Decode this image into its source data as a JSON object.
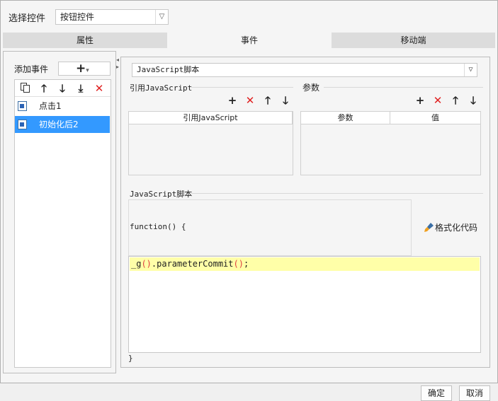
{
  "header": {
    "select_label": "选择控件",
    "control_value": "按钮控件"
  },
  "tabs": [
    {
      "label": "属性"
    },
    {
      "label": "事件"
    },
    {
      "label": "移动端"
    }
  ],
  "events": {
    "add_label": "添加事件",
    "items": [
      {
        "label": "点击1"
      },
      {
        "label": "初始化后2"
      }
    ]
  },
  "script": {
    "type_value": "JavaScript脚本",
    "ref_title": "引用JavaScript",
    "ref_column": "引用JavaScript",
    "param_title": "参数",
    "param_col_name": "参数",
    "param_col_value": "值",
    "script_title": "JavaScript脚本",
    "func_header": "function() {",
    "format_label": "格式化代码",
    "code_prefix": "_g",
    "code_paren1": "()",
    "code_middle": ".parameterCommit",
    "code_paren2": "()",
    "code_suffix": ";",
    "closing_brace": "}"
  },
  "footer": {
    "ok_label": "确定",
    "cancel_label": "取消"
  }
}
